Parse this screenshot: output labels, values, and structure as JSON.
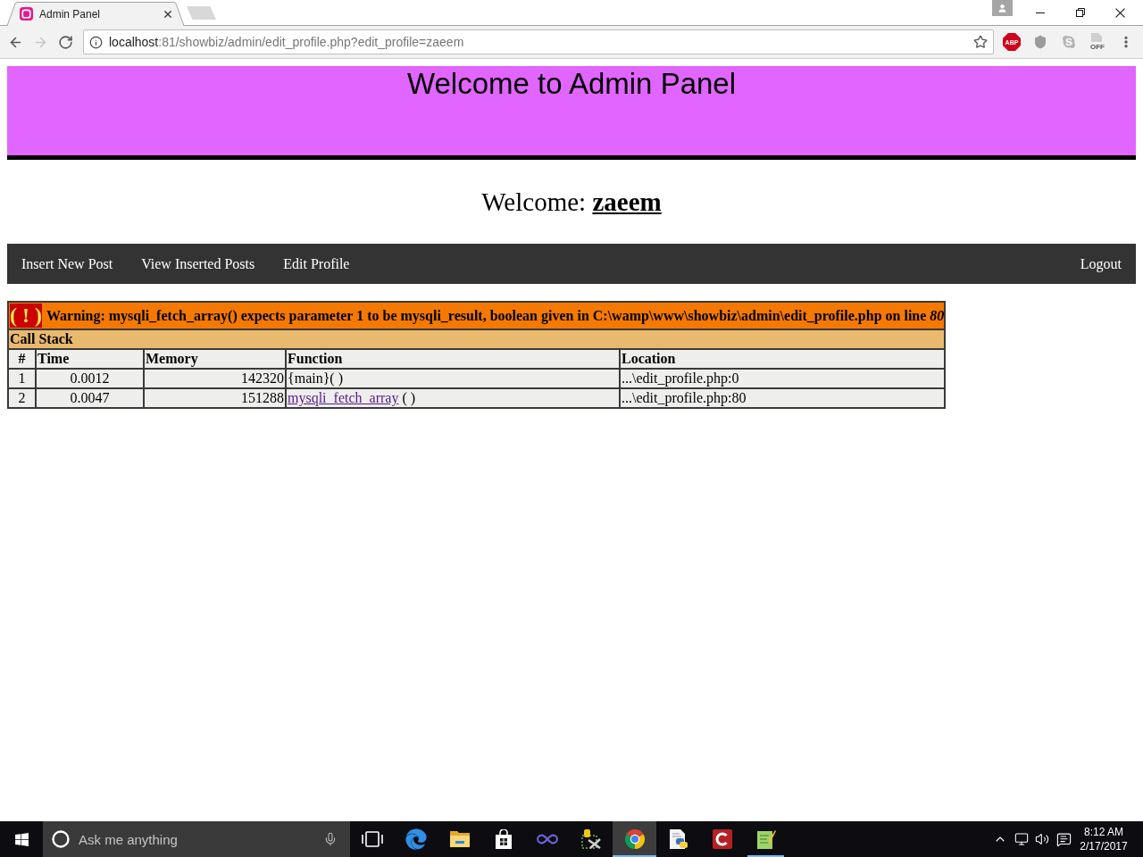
{
  "browser": {
    "tabs": [
      {
        "title": "Admin Panel",
        "selected": true
      }
    ],
    "nav_buttons": [
      {
        "kind": "back",
        "disabled": false
      },
      {
        "kind": "forward",
        "disabled": true
      },
      {
        "kind": "reload",
        "disabled": false
      }
    ],
    "address": {
      "host": "localhost",
      "rest": ":81/showbiz/admin/edit_profile.php?edit_profile=zaeem"
    },
    "extensions": [
      {
        "kind": "abp",
        "label": "ABP"
      },
      {
        "kind": "shield"
      },
      {
        "kind": "skype"
      },
      {
        "kind": "off",
        "label": "OFF"
      }
    ]
  },
  "header": {
    "title": "Welcome to Admin Panel"
  },
  "welcome": {
    "label": "Welcome:",
    "user": "zaeem"
  },
  "nav": {
    "main_links": [
      "Insert New Post",
      "View Inserted Posts",
      "Edit Profile"
    ],
    "end_links": [
      "Logout"
    ]
  },
  "error": {
    "badge": "( ! )",
    "message": "Warning: mysqli_fetch_array() expects parameter 1 to be mysqli_result, boolean given in C:\\wamp\\www\\showbiz\\admin\\edit_profile.php on line *80*",
    "call_stack": {
      "title": "Call Stack",
      "columns": [
        "#",
        "Time",
        "Memory",
        "Function",
        "Location"
      ],
      "rows": [
        {
          "index": "1",
          "time": "0.0012",
          "memory": "142320",
          "function": {
            "name": "{main}",
            "args": "( )",
            "linked": false
          },
          "location": "...\\edit_profile.php:0"
        },
        {
          "index": "2",
          "time": "0.0047",
          "memory": "151288",
          "function": {
            "name": "mysqli_fetch_array",
            "args": "( )",
            "linked": true
          },
          "location": "...\\edit_profile.php:80"
        }
      ]
    }
  },
  "taskbar": {
    "search": {
      "placeholder": "Ask me anything"
    },
    "apps": [
      {
        "kind": "task_view",
        "running": false,
        "selected": false
      },
      {
        "kind": "edge",
        "running": false,
        "selected": false
      },
      {
        "kind": "explorer",
        "running": false,
        "selected": false
      },
      {
        "kind": "store",
        "running": false,
        "selected": false
      },
      {
        "kind": "infinity",
        "running": false,
        "selected": false
      },
      {
        "kind": "tools",
        "running": false,
        "selected": false
      },
      {
        "kind": "chrome",
        "running": true,
        "selected": true
      },
      {
        "kind": "python",
        "running": false,
        "selected": false
      },
      {
        "kind": "red_c",
        "running": false,
        "selected": false
      },
      {
        "kind": "notepad",
        "running": true,
        "selected": false
      }
    ],
    "clock": {
      "time": "8:12 AM",
      "date": "2/17/2017"
    }
  }
}
